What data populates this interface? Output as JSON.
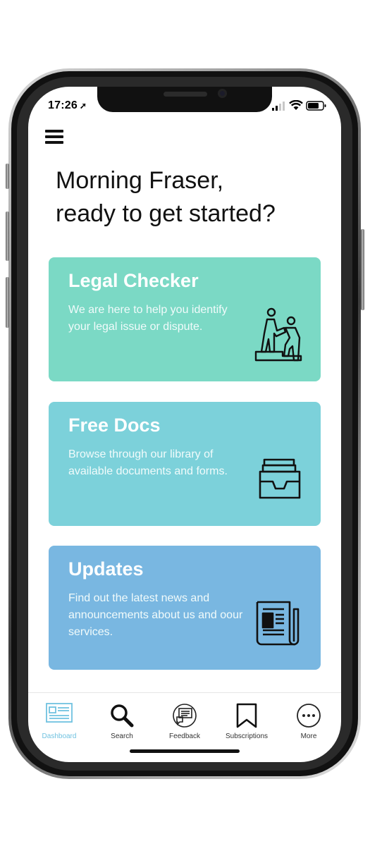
{
  "status_bar": {
    "time": "17:26",
    "location_arrow": "location-arrow-icon",
    "signal": "signal-icon",
    "wifi": "wifi-icon",
    "battery": "battery-icon"
  },
  "header": {
    "menu_icon": "hamburger-menu-icon"
  },
  "greeting": {
    "line1": "Morning Fraser,",
    "line2": "ready to get started?"
  },
  "cards": [
    {
      "title": "Legal Checker",
      "description": "We are here to help you identify your legal issue or dispute.",
      "icon": "people-helping-icon",
      "color": "#7bd9c5"
    },
    {
      "title": "Free Docs",
      "description": "Browse through our library of available documents and forms.",
      "icon": "document-tray-icon",
      "color": "#7cd1da"
    },
    {
      "title": "Updates",
      "description": "Find out the latest news and announcements about us and oour services.",
      "icon": "newspaper-icon",
      "color": "#79b7e1"
    }
  ],
  "tabbar": {
    "active_color": "#70c2e0",
    "items": [
      {
        "label": "Dashboard",
        "icon": "dashboard-icon",
        "active": true
      },
      {
        "label": "Search",
        "icon": "search-icon",
        "active": false
      },
      {
        "label": "Feedback",
        "icon": "feedback-icon",
        "active": false
      },
      {
        "label": "Subscriptions",
        "icon": "bookmark-icon",
        "active": false
      },
      {
        "label": "More",
        "icon": "more-icon",
        "active": false
      }
    ]
  }
}
